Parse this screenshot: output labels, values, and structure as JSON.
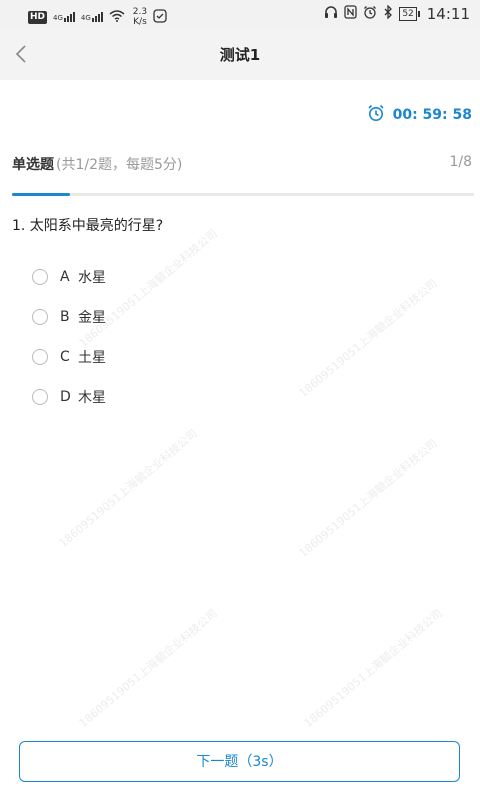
{
  "status_bar": {
    "hd": "HD",
    "network1": "4G",
    "network2": "4G",
    "speed_value": "2.3",
    "speed_unit": "K/s",
    "battery": "52",
    "time": "14:11"
  },
  "header": {
    "back_icon": "chevron-left-icon",
    "title": "测试1"
  },
  "timer": {
    "icon": "alarm-clock-icon",
    "value": "00: 59: 58"
  },
  "section": {
    "title": "单选题",
    "subtitle": "(共1/2题，每题5分)",
    "progress_text": "1/8",
    "progress_fraction": 0.125
  },
  "question": {
    "text": "1. 太阳系中最亮的行星?"
  },
  "options": [
    {
      "letter": "A",
      "text": "水星"
    },
    {
      "letter": "B",
      "text": "金星"
    },
    {
      "letter": "C",
      "text": "土星"
    },
    {
      "letter": "D",
      "text": "木星"
    }
  ],
  "watermark": "18609519051上海毓企业科技公司",
  "next_button": "下一题（3s）",
  "colors": {
    "accent": "#1a87cf"
  }
}
